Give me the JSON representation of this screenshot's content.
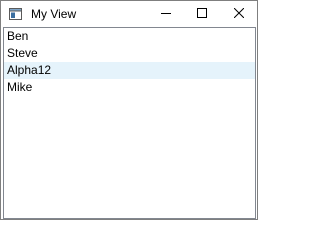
{
  "window": {
    "title": "My View",
    "icon": "window-app-icon",
    "controls": {
      "minimize_icon": "minimize-icon",
      "maximize_icon": "maximize-icon",
      "close_icon": "close-icon"
    }
  },
  "list": {
    "items": [
      {
        "label": "Ben"
      },
      {
        "label": "Steve"
      },
      {
        "label": "Alpha12",
        "highlighted": true
      },
      {
        "label": "Mike"
      }
    ],
    "highlight_color": "#e5f3fb"
  }
}
